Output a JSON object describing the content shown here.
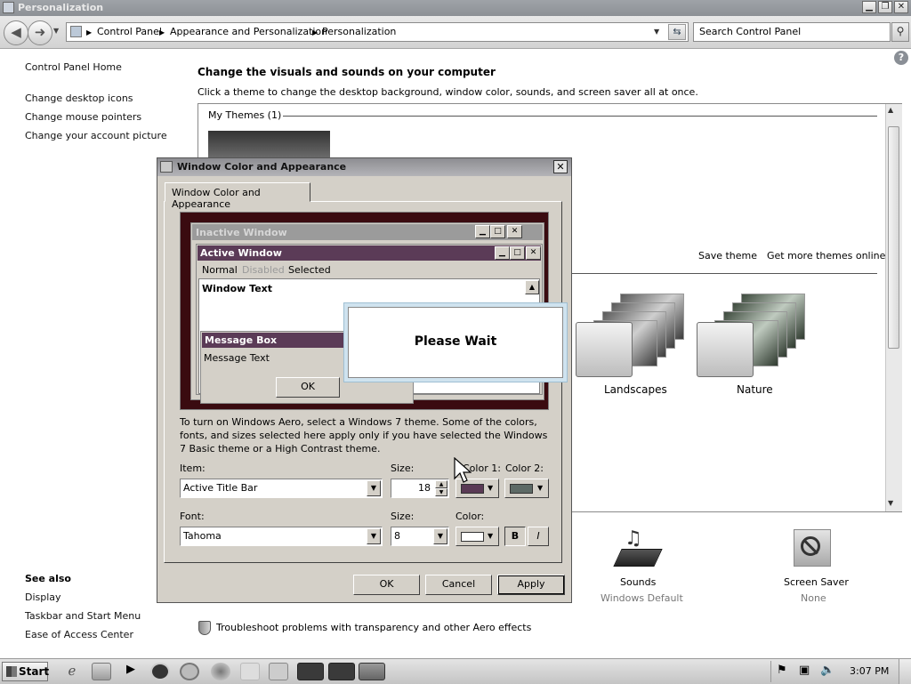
{
  "window": {
    "title": "Personalization"
  },
  "address": {
    "crumbs": [
      "Control Panel",
      "Appearance and Personalization",
      "Personalization"
    ],
    "search_placeholder": "Search Control Panel"
  },
  "left": {
    "home": "Control Panel Home",
    "links": [
      "Change desktop icons",
      "Change mouse pointers",
      "Change your account picture"
    ],
    "see_also_title": "See also",
    "see_also": [
      "Display",
      "Taskbar and Start Menu",
      "Ease of Access Center"
    ]
  },
  "main": {
    "title": "Change the visuals and sounds on your computer",
    "subtitle": "Click a theme to change the desktop background, window color, sounds, and screen saver all at once.",
    "my_themes": "My Themes (1)",
    "save_theme": "Save theme",
    "get_more": "Get more themes online",
    "themes": [
      "Landscapes",
      "Nature"
    ],
    "sounds_label": "Sounds",
    "sounds_value": "Windows Default",
    "screensaver_label": "Screen Saver",
    "screensaver_value": "None",
    "troubleshoot": "Troubleshoot problems with transparency and other Aero effects"
  },
  "dialog": {
    "title": "Window Color and Appearance",
    "tab": "Window Color and Appearance",
    "preview": {
      "inactive": "Inactive Window",
      "active": "Active Window",
      "menu": [
        "Normal",
        "Disabled",
        "Selected"
      ],
      "window_text": "Window Text",
      "message_box": "Message Box",
      "message_text": "Message Text",
      "ok": "OK"
    },
    "description": "To turn on Windows Aero, select a Windows 7 theme.  Some of the colors, fonts, and sizes selected here apply only if you have selected the Windows 7 Basic theme or a High Contrast theme.",
    "item_label": "Item:",
    "item_value": "Active Title Bar",
    "size_label": "Size:",
    "size_value": "18",
    "color1_label": "Color 1:",
    "color2_label": "Color 2:",
    "color1": "#5a3a55",
    "color2": "#5d6a66",
    "font_label": "Font:",
    "font_value": "Tahoma",
    "font_size_label": "Size:",
    "font_size_value": "8",
    "font_color_label": "Color:",
    "font_color": "#ffffff",
    "bold": "B",
    "italic": "I",
    "ok": "OK",
    "cancel": "Cancel",
    "apply": "Apply"
  },
  "please_wait": "Please Wait",
  "taskbar": {
    "start": "Start",
    "clock": "3:07 PM"
  },
  "colors": {
    "active_title": "#5b3b57",
    "inactive_title": "#9b9b9b",
    "preview_bg": "#3a0b10"
  }
}
